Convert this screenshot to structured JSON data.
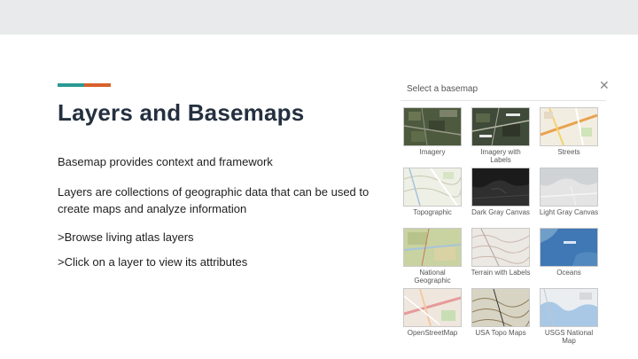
{
  "slide": {
    "title": "Layers and Basemaps",
    "paragraphs": [
      "Basemap provides context and framework",
      "Layers are collections of geographic data that can be used to create maps and analyze information",
      ">Browse living atlas layers",
      ">Click on a layer to view its attributes"
    ]
  },
  "colors": {
    "accent_teal": "#2a9a92",
    "accent_orange": "#d8612a",
    "topbar": "#e9eaeb",
    "title": "#24303f"
  },
  "basemap_panel": {
    "title": "Select a basemap",
    "close_icon": "close-icon",
    "options": [
      {
        "label": "Imagery"
      },
      {
        "label": "Imagery with Labels"
      },
      {
        "label": "Streets"
      },
      {
        "label": "Topographic"
      },
      {
        "label": "Dark Gray Canvas"
      },
      {
        "label": "Light Gray Canvas"
      },
      {
        "label": "National Geographic"
      },
      {
        "label": "Terrain with Labels"
      },
      {
        "label": "Oceans"
      },
      {
        "label": "OpenStreetMap"
      },
      {
        "label": "USA Topo Maps"
      },
      {
        "label": "USGS National Map"
      }
    ]
  }
}
